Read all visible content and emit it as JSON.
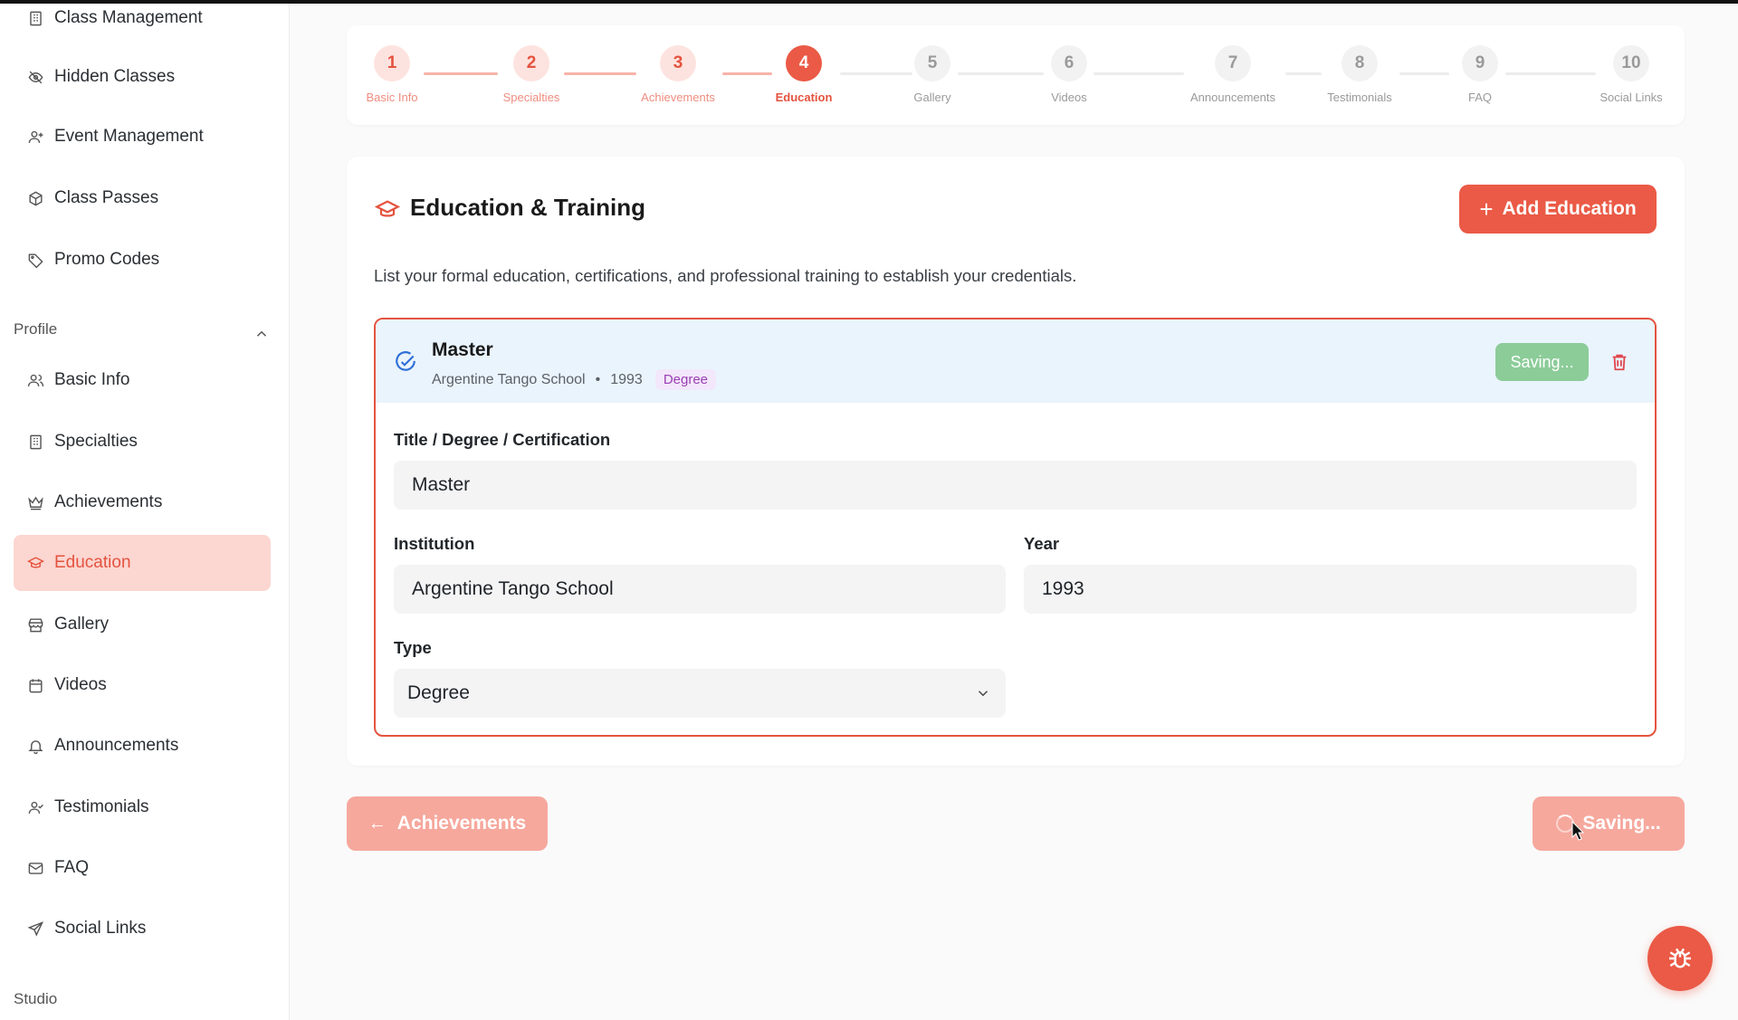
{
  "sidebar": {
    "items_top": [
      {
        "label": "Class Management",
        "icon": "building-icon"
      },
      {
        "label": "Hidden Classes",
        "icon": "eye-off-icon"
      },
      {
        "label": "Event Management",
        "icon": "user-plus-icon"
      },
      {
        "label": "Class Passes",
        "icon": "package-icon"
      },
      {
        "label": "Promo Codes",
        "icon": "tag-icon"
      }
    ],
    "profile_section_label": "Profile",
    "profile_items": [
      {
        "label": "Basic Info",
        "icon": "users-icon"
      },
      {
        "label": "Specialties",
        "icon": "building-icon"
      },
      {
        "label": "Achievements",
        "icon": "crown-icon"
      },
      {
        "label": "Education",
        "icon": "graduation-cap-icon",
        "active": true
      },
      {
        "label": "Gallery",
        "icon": "store-icon"
      },
      {
        "label": "Videos",
        "icon": "calendar-icon"
      },
      {
        "label": "Announcements",
        "icon": "bell-icon"
      },
      {
        "label": "Testimonials",
        "icon": "user-check-icon"
      },
      {
        "label": "FAQ",
        "icon": "mail-icon"
      },
      {
        "label": "Social Links",
        "icon": "send-icon"
      }
    ],
    "studio_section_label": "Studio"
  },
  "stepper": {
    "steps": [
      {
        "number": "1",
        "label": "Basic Info",
        "state": "done"
      },
      {
        "number": "2",
        "label": "Specialties",
        "state": "done"
      },
      {
        "number": "3",
        "label": "Achievements",
        "state": "done"
      },
      {
        "number": "4",
        "label": "Education",
        "state": "current"
      },
      {
        "number": "5",
        "label": "Gallery",
        "state": "todo"
      },
      {
        "number": "6",
        "label": "Videos",
        "state": "todo"
      },
      {
        "number": "7",
        "label": "Announcements",
        "state": "todo"
      },
      {
        "number": "8",
        "label": "Testimonials",
        "state": "todo"
      },
      {
        "number": "9",
        "label": "FAQ",
        "state": "todo"
      },
      {
        "number": "10",
        "label": "Social Links",
        "state": "todo"
      }
    ]
  },
  "section": {
    "title": "Education & Training",
    "add_button_label": "Add Education",
    "description": "List your formal education, certifications, and professional training to establish your credentials."
  },
  "entry": {
    "name": "Master",
    "institution": "Argentine Tango School",
    "year": "1993",
    "type_badge": "Degree",
    "saving_label": "Saving...",
    "fields": {
      "title_label": "Title / Degree / Certification",
      "title_value": "Master",
      "institution_label": "Institution",
      "institution_value": "Argentine Tango School",
      "year_label": "Year",
      "year_value": "1993",
      "type_label": "Type",
      "type_value": "Degree"
    }
  },
  "footer": {
    "back_label": "Achievements",
    "save_label": "Saving..."
  },
  "colors": {
    "accent": "#ea5a46",
    "accent_light": "#fcd6d1",
    "saving_green": "#8ccc99",
    "badge_purple": "#9b3fb4"
  }
}
